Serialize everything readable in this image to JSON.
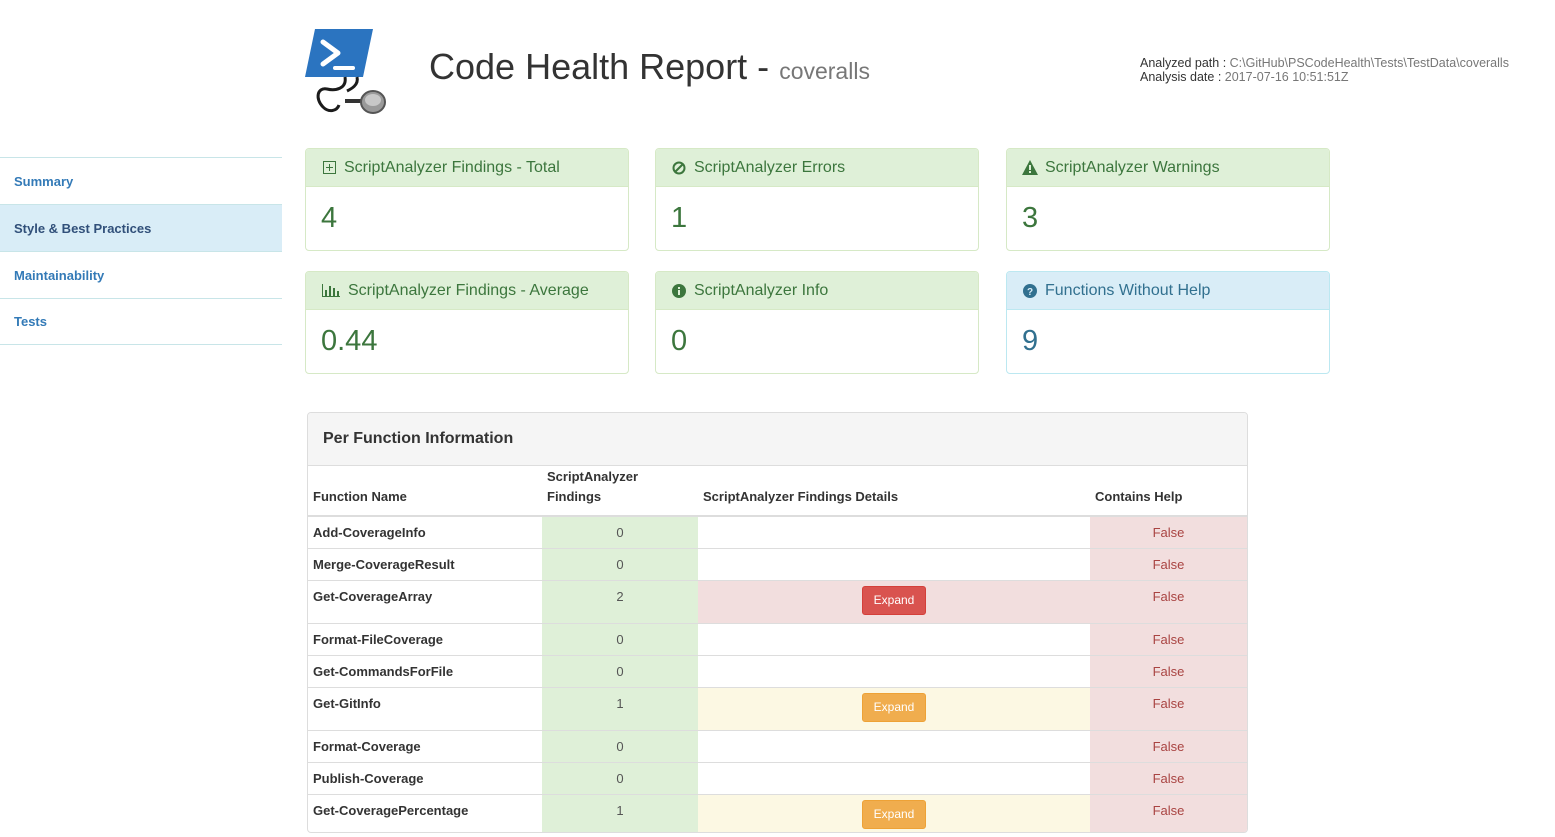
{
  "header": {
    "title": "Code Health Report -",
    "subtitle": "coveralls",
    "analyzed_path_label": "Analyzed path :",
    "analyzed_path_value": "C:\\GitHub\\PSCodeHealth\\Tests\\TestData\\coveralls",
    "analysis_date_label": "Analysis date :",
    "analysis_date_value": "2017-07-16 10:51:51Z"
  },
  "sidebar": {
    "items": [
      {
        "label": "Summary",
        "active": false
      },
      {
        "label": "Style & Best Practices",
        "active": true
      },
      {
        "label": "Maintainability",
        "active": false
      },
      {
        "label": "Tests",
        "active": false
      }
    ]
  },
  "panels": [
    {
      "title": "ScriptAnalyzer Findings - Total",
      "value": "4",
      "icon": "plus-square-icon",
      "style": "success"
    },
    {
      "title": "ScriptAnalyzer Errors",
      "value": "1",
      "icon": "ban-icon",
      "style": "success"
    },
    {
      "title": "ScriptAnalyzer Warnings",
      "value": "3",
      "icon": "warning-icon",
      "style": "success"
    },
    {
      "title": "ScriptAnalyzer Findings - Average",
      "value": "0.44",
      "icon": "bar-chart-icon",
      "style": "success"
    },
    {
      "title": "ScriptAnalyzer Info",
      "value": "0",
      "icon": "info-icon",
      "style": "success"
    },
    {
      "title": "Functions Without Help",
      "value": "9",
      "icon": "question-icon",
      "style": "info"
    }
  ],
  "table": {
    "heading": "Per Function Information",
    "columns": [
      "Function Name",
      "ScriptAnalyzer Findings",
      "ScriptAnalyzer Findings Details",
      "Contains Help"
    ],
    "expand_label": "Expand",
    "rows": [
      {
        "name": "Add-CoverageInfo",
        "findings": "0",
        "help": "False",
        "details": ""
      },
      {
        "name": "Merge-CoverageResult",
        "findings": "0",
        "help": "False",
        "details": ""
      },
      {
        "name": "Get-CoverageArray",
        "findings": "2",
        "help": "False",
        "details": "danger"
      },
      {
        "name": "Format-FileCoverage",
        "findings": "0",
        "help": "False",
        "details": ""
      },
      {
        "name": "Get-CommandsForFile",
        "findings": "0",
        "help": "False",
        "details": ""
      },
      {
        "name": "Get-GitInfo",
        "findings": "1",
        "help": "False",
        "details": "warning"
      },
      {
        "name": "Format-Coverage",
        "findings": "0",
        "help": "False",
        "details": ""
      },
      {
        "name": "Publish-Coverage",
        "findings": "0",
        "help": "False",
        "details": ""
      },
      {
        "name": "Get-CoveragePercentage",
        "findings": "1",
        "help": "False",
        "details": "warning"
      }
    ]
  },
  "colors": {
    "success_bg": "#dff0d8",
    "success_text": "#3c763d",
    "info_bg": "#d9edf7",
    "info_text": "#31708f",
    "danger_bg": "#f2dede",
    "danger_text": "#a94442",
    "warning_bg": "#fcf8e3",
    "link": "#337ab7"
  }
}
